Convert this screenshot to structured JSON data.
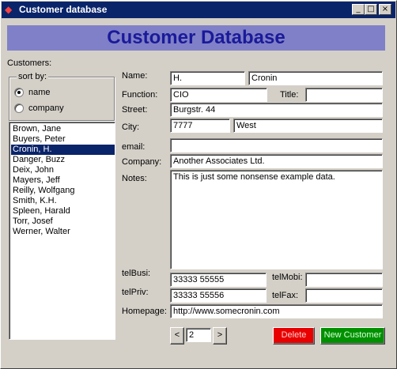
{
  "window": {
    "title": "Customer database"
  },
  "header": {
    "title": "Customer Database"
  },
  "sidebar": {
    "customers_label": "Customers:",
    "sort_label": "sort by:",
    "sort_options": [
      {
        "label": "name",
        "checked": true
      },
      {
        "label": "company",
        "checked": false
      }
    ],
    "customers": [
      "Brown, Jane",
      "Buyers, Peter",
      "Cronin, H.",
      "Danger, Buzz",
      "Deix, John",
      "Mayers, Jeff",
      "Reilly, Wolfgang",
      "Smith, K.H.",
      "Spleen, Harald",
      "Torr, Josef",
      "Werner, Walter"
    ],
    "selected_customer": "Cronin, H."
  },
  "form": {
    "name_label": "Name:",
    "first_name": "H.",
    "last_name": "Cronin",
    "function_label": "Function:",
    "function": "CIO",
    "title_label": "Title:",
    "title": "",
    "street_label": "Street:",
    "street": "Burgstr. 44",
    "city_label": "City:",
    "zip": "7777",
    "city": "West",
    "email_label": "email:",
    "email": "",
    "company_label": "Company:",
    "company": "Another Associates Ltd.",
    "notes_label": "Notes:",
    "notes": "This is just some nonsense example data.",
    "telbusi_label": "telBusi:",
    "telbusi": "33333 55555",
    "telmobi_label": "telMobi:",
    "telmobi": "",
    "telpriv_label": "telPriv:",
    "telpriv": "33333 55556",
    "telfax_label": "telFax:",
    "telfax": "",
    "homepage_label": "Homepage:",
    "homepage": "http://www.somecronin.com"
  },
  "pager": {
    "prev_symbol": "<",
    "page": "2",
    "next_symbol": ">"
  },
  "actions": {
    "delete_label": "Delete",
    "new_customer_label": "New Customer"
  },
  "colors": {
    "delete": "#e80000",
    "new_customer": "#009000",
    "header_band": "#8080c8",
    "header_text": "#1a1a9a"
  },
  "icons": [
    "app-icon",
    "minimize-icon",
    "maximize-icon",
    "close-icon"
  ]
}
